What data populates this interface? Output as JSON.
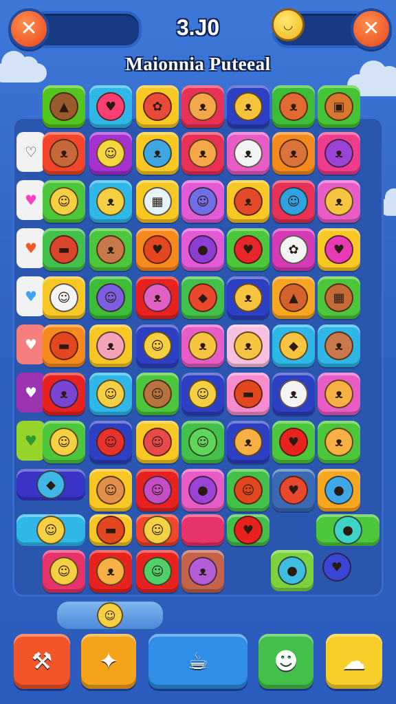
{
  "hud": {
    "score": "3.J0",
    "level_title": "Maionnia Puteeal",
    "close_icon_left": "close-icon",
    "close_icon_right": "close-icon",
    "avatar_icon": "smiley-icon",
    "accent": "#e9441d"
  },
  "bottom_bar": {
    "buttons": [
      {
        "icon": "hammer-icon",
        "glyph": "⚒",
        "color": "#f2552a"
      },
      {
        "icon": "shuffle-icon",
        "glyph": "✦",
        "color": "#f5a31a"
      },
      {
        "icon": "cup-icon",
        "glyph": "☕",
        "color": "#2f8fe6"
      },
      {
        "icon": "chick-icon",
        "glyph": "☻",
        "color": "#43c04a"
      },
      {
        "icon": "cloud-icon",
        "glyph": "☁",
        "color": "#f8cf2a"
      }
    ],
    "booster_pill_icon": "smiley-icon"
  },
  "board": {
    "side_hearts": [
      {
        "icon": "heart-icon",
        "glyph": "♡",
        "color": "#f2f2f2"
      },
      {
        "icon": "heart-icon",
        "glyph": "♥",
        "color": "#f2f2f2"
      },
      {
        "icon": "heart-icon",
        "glyph": "♥",
        "color": "#f2f2f2"
      },
      {
        "icon": "heart-icon",
        "glyph": "♥",
        "color": "#f2f2f2"
      },
      {
        "icon": "heart-icon",
        "glyph": "♥",
        "color": "#f57e7e"
      },
      {
        "icon": "heart-icon",
        "glyph": "♥",
        "color": "#9c33b0"
      },
      {
        "icon": "heart-icon",
        "glyph": "♥",
        "color": "#96d42c"
      }
    ],
    "rows": [
      [
        {
          "icon": "fox-icon",
          "color": "#52c61f",
          "face": "#9a5a2e",
          "mark": "▲"
        },
        {
          "icon": "heart-icon",
          "color": "#2fb7e8",
          "face": "#ff3e72",
          "mark": "♥"
        },
        {
          "icon": "flower-icon",
          "color": "#f7c723",
          "face": "#e94a3a",
          "mark": "✿"
        },
        {
          "icon": "cat-icon",
          "color": "#e83155",
          "face": "#f4a84a",
          "mark": "ᴥ"
        },
        {
          "icon": "cat-icon",
          "color": "#2d3fc3",
          "face": "#f5c43b",
          "mark": "ᴥ"
        },
        {
          "icon": "bear-icon",
          "color": "#3dbd35",
          "face": "#e06a32",
          "mark": "ᴥ"
        },
        {
          "icon": "box-icon",
          "color": "#45c435",
          "face": "#d8772e",
          "mark": "▣"
        }
      ],
      [
        {
          "icon": "cat-icon",
          "color": "#f4462a",
          "face": "#c7683a",
          "mark": "ᴥ"
        },
        {
          "icon": "chick-icon",
          "color": "#a730d1",
          "face": "#f5d640",
          "mark": "☺"
        },
        {
          "icon": "cat-icon",
          "color": "#f7c723",
          "face": "#3ea7e0",
          "mark": "ᴥ"
        },
        {
          "icon": "cat-icon",
          "color": "#e83155",
          "face": "#f4a84a",
          "mark": "ᴥ"
        },
        {
          "icon": "cat-icon",
          "color": "#e85cc6",
          "face": "#f4f4f4",
          "mark": "ᴥ"
        },
        {
          "icon": "fox-icon",
          "color": "#f78a1d",
          "face": "#d9733a",
          "mark": "ᴥ"
        },
        {
          "icon": "devil-icon",
          "color": "#ef3c8d",
          "face": "#9b43d6",
          "mark": "ᴥ"
        }
      ],
      [
        {
          "icon": "chick-icon",
          "color": "#4cc63a",
          "face": "#f6d043",
          "mark": "☺"
        },
        {
          "icon": "cat-icon",
          "color": "#2fb7e8",
          "face": "#f6d043",
          "mark": "ᴥ"
        },
        {
          "icon": "cake-icon",
          "color": "#f7c723",
          "face": "#e6f4fa",
          "mark": "▦"
        },
        {
          "icon": "blob-icon",
          "color": "#e25ad6",
          "face": "#6f6ee6",
          "mark": "☺"
        },
        {
          "icon": "bear-icon",
          "color": "#f7c723",
          "face": "#e24a2a",
          "mark": "ᴥ"
        },
        {
          "icon": "blob-icon",
          "color": "#e83155",
          "face": "#2fa3e0",
          "mark": "☺"
        },
        {
          "icon": "fox-icon",
          "color": "#e85cc6",
          "face": "#f6c440",
          "mark": "ᴥ"
        }
      ],
      [
        {
          "icon": "hat-icon",
          "color": "#43c04a",
          "face": "#d9442a",
          "mark": "▬"
        },
        {
          "icon": "deer-icon",
          "color": "#4cc63a",
          "face": "#c9784a",
          "mark": "ᴥ"
        },
        {
          "icon": "heart-icon",
          "color": "#f78a1d",
          "face": "#e2471f",
          "mark": "♥"
        },
        {
          "icon": "balloon-icon",
          "color": "#e25ad6",
          "face": "#8a3ed3",
          "mark": "●"
        },
        {
          "icon": "heart-icon",
          "color": "#4cc63a",
          "face": "#e6262a",
          "mark": "♥"
        },
        {
          "icon": "sheep-icon",
          "color": "#d63ab7",
          "face": "#f4f4f4",
          "mark": "✿"
        },
        {
          "icon": "heart-icon",
          "color": "#f7c723",
          "face": "#e83ab4",
          "mark": "♥"
        }
      ],
      [
        {
          "icon": "cloud-icon",
          "color": "#f7c723",
          "face": "#f4f4f4",
          "mark": "☺"
        },
        {
          "icon": "blob-icon",
          "color": "#3dbd35",
          "face": "#7e5ee0",
          "mark": "☺"
        },
        {
          "icon": "cat-icon",
          "color": "#e8231f",
          "face": "#e060c4",
          "mark": "ᴥ"
        },
        {
          "icon": "diamond-icon",
          "color": "#43c04a",
          "face": "#e8492c",
          "mark": "◆"
        },
        {
          "icon": "cat-icon",
          "color": "#2d3fc3",
          "face": "#f6c440",
          "mark": "ᴥ"
        },
        {
          "icon": "blob-icon",
          "color": "#f7a61f",
          "face": "#d4622c",
          "mark": "▲"
        },
        {
          "icon": "box-icon",
          "color": "#4cc63a",
          "face": "#c46b38",
          "mark": "▦"
        }
      ],
      [
        {
          "icon": "hat-icon",
          "color": "#f78a1d",
          "face": "#e2471f",
          "mark": "▬"
        },
        {
          "icon": "pig-icon",
          "color": "#f7c723",
          "face": "#f5a3b8",
          "mark": "ᴥ"
        },
        {
          "icon": "chick-icon",
          "color": "#2d3fc3",
          "face": "#f6d043",
          "mark": "☺"
        },
        {
          "icon": "fox-icon",
          "color": "#e85cc6",
          "face": "#f6c440",
          "mark": "ᴥ"
        },
        {
          "icon": "fox-icon",
          "color": "#f7bfe0",
          "face": "#f6c440",
          "mark": "ᴥ"
        },
        {
          "icon": "diamond-icon",
          "color": "#2fb7e8",
          "face": "#f6c440",
          "mark": "◆"
        },
        {
          "icon": "deer-icon",
          "color": "#2fb7e8",
          "face": "#c9784a",
          "mark": "ᴥ"
        }
      ],
      [
        {
          "icon": "devil-icon",
          "color": "#e8231f",
          "face": "#7b45d4",
          "mark": "ᴥ"
        },
        {
          "icon": "chick-icon",
          "color": "#2fb7e8",
          "face": "#f6d043",
          "mark": "☺"
        },
        {
          "icon": "blob-icon",
          "color": "#4cc63a",
          "face": "#b6723f",
          "mark": "☺"
        },
        {
          "icon": "chick-icon",
          "color": "#2d3fc3",
          "face": "#f6d043",
          "mark": "☺"
        },
        {
          "icon": "hat-icon",
          "color": "#f68ccf",
          "face": "#e2471f",
          "mark": "▬"
        },
        {
          "icon": "cat-icon",
          "color": "#2d3fc3",
          "face": "#f4f4f4",
          "mark": "ᴥ"
        },
        {
          "icon": "cat-icon",
          "color": "#e85cc6",
          "face": "#f6b043",
          "mark": "ᴥ"
        }
      ],
      [
        {
          "icon": "chick-icon",
          "color": "#4cc63a",
          "face": "#f6d043",
          "mark": "☺"
        },
        {
          "icon": "blob-icon",
          "color": "#2d3fc3",
          "face": "#e8332c",
          "mark": "☺"
        },
        {
          "icon": "blob-icon",
          "color": "#f7c723",
          "face": "#e84a4a",
          "mark": "☺"
        },
        {
          "icon": "frog-icon",
          "color": "#43c04a",
          "face": "#5fd65a",
          "mark": "☺"
        },
        {
          "icon": "fox-icon",
          "color": "#2d3fc3",
          "face": "#f6b043",
          "mark": "ᴥ"
        },
        {
          "icon": "heart-icon",
          "color": "#4cc63a",
          "face": "#e8231f",
          "mark": "♥"
        },
        {
          "icon": "cat-icon",
          "color": "#4cc63a",
          "face": "#f6b043",
          "mark": "ᴥ"
        }
      ],
      [
        {
          "icon": "blob-icon",
          "color": "#f7c723",
          "face": "#e0904a",
          "mark": "☺"
        },
        {
          "icon": "blob-icon",
          "color": "#e8231f",
          "face": "#c44fc4",
          "mark": "☺"
        },
        {
          "icon": "blob-icon",
          "color": "#e85cc6",
          "face": "#9a43d6",
          "mark": "●"
        },
        {
          "icon": "blob-icon",
          "color": "#43c04a",
          "face": "#e2471f",
          "mark": "☺"
        },
        {
          "icon": "heart-icon",
          "color": "#3a6ab4",
          "face": "#e8492c",
          "mark": "♥"
        },
        {
          "icon": "drop-icon",
          "color": "#f7a61f",
          "face": "#3fa7e6",
          "mark": "●"
        }
      ],
      [
        {
          "icon": "hat-icon",
          "color": "#f7c723",
          "face": "#e2471f",
          "mark": "▬"
        },
        {
          "icon": "face-icon",
          "color": "#f4462a",
          "face": "#f6d043",
          "mark": "☺"
        },
        {
          "icon": "tile-icon",
          "color": "#e8336a",
          "face": "#e8336a",
          "mark": ""
        },
        {
          "icon": "heart-icon",
          "color": "#43c04a",
          "face": "#e8231f",
          "mark": "♥"
        }
      ],
      [
        {
          "icon": "face-icon",
          "color": "#e8336a",
          "face": "#f6d043",
          "mark": "☺"
        },
        {
          "icon": "cat-icon",
          "color": "#e8231f",
          "face": "#f6b043",
          "mark": "ᴥ"
        },
        {
          "icon": "blob-icon",
          "color": "#e8231f",
          "face": "#4fd06a",
          "mark": "☺"
        },
        {
          "icon": "devil-icon",
          "color": "#c4624a",
          "face": "#b35ed6",
          "mark": "ᴥ"
        }
      ]
    ],
    "long_tiles": [
      {
        "icon": "bird-icon",
        "color": "#3a33c7",
        "face": "#3fb6e6",
        "mark": "◆"
      },
      {
        "icon": "chick-icon",
        "color": "#2fb7e8",
        "face": "#f6d043",
        "mark": "☺"
      },
      {
        "icon": "bubble-icon",
        "color": "#4cc63a",
        "face": "#3fd2c6",
        "mark": "●"
      },
      {
        "icon": "bubble-icon",
        "color": "#7bd23c",
        "face": "#3fbde0",
        "mark": "●"
      },
      {
        "icon": "heart-icon",
        "color": "#2a56b0",
        "face": "#3a45d6",
        "mark": "♥"
      }
    ]
  }
}
